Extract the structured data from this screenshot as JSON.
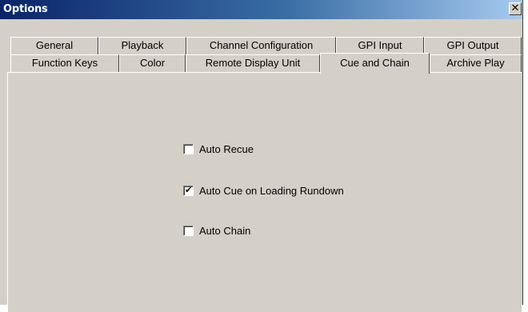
{
  "window": {
    "title": "Options",
    "close_glyph": "✕"
  },
  "tabs_row1": [
    {
      "label": "General"
    },
    {
      "label": "Playback"
    },
    {
      "label": "Channel Configuration"
    },
    {
      "label": "GPI Input"
    },
    {
      "label": "GPI Output"
    }
  ],
  "tabs_row2": [
    {
      "label": "Function Keys"
    },
    {
      "label": "Color"
    },
    {
      "label": "Remote Display Unit"
    },
    {
      "label": "Cue and Chain",
      "selected": true
    },
    {
      "label": "Archive Play"
    }
  ],
  "options": [
    {
      "label": "Auto Recue",
      "checked": false
    },
    {
      "label": "Auto Cue on Loading Rundown",
      "checked": true
    },
    {
      "label": "Auto Chain",
      "checked": false
    }
  ],
  "check_glyph": "✔"
}
